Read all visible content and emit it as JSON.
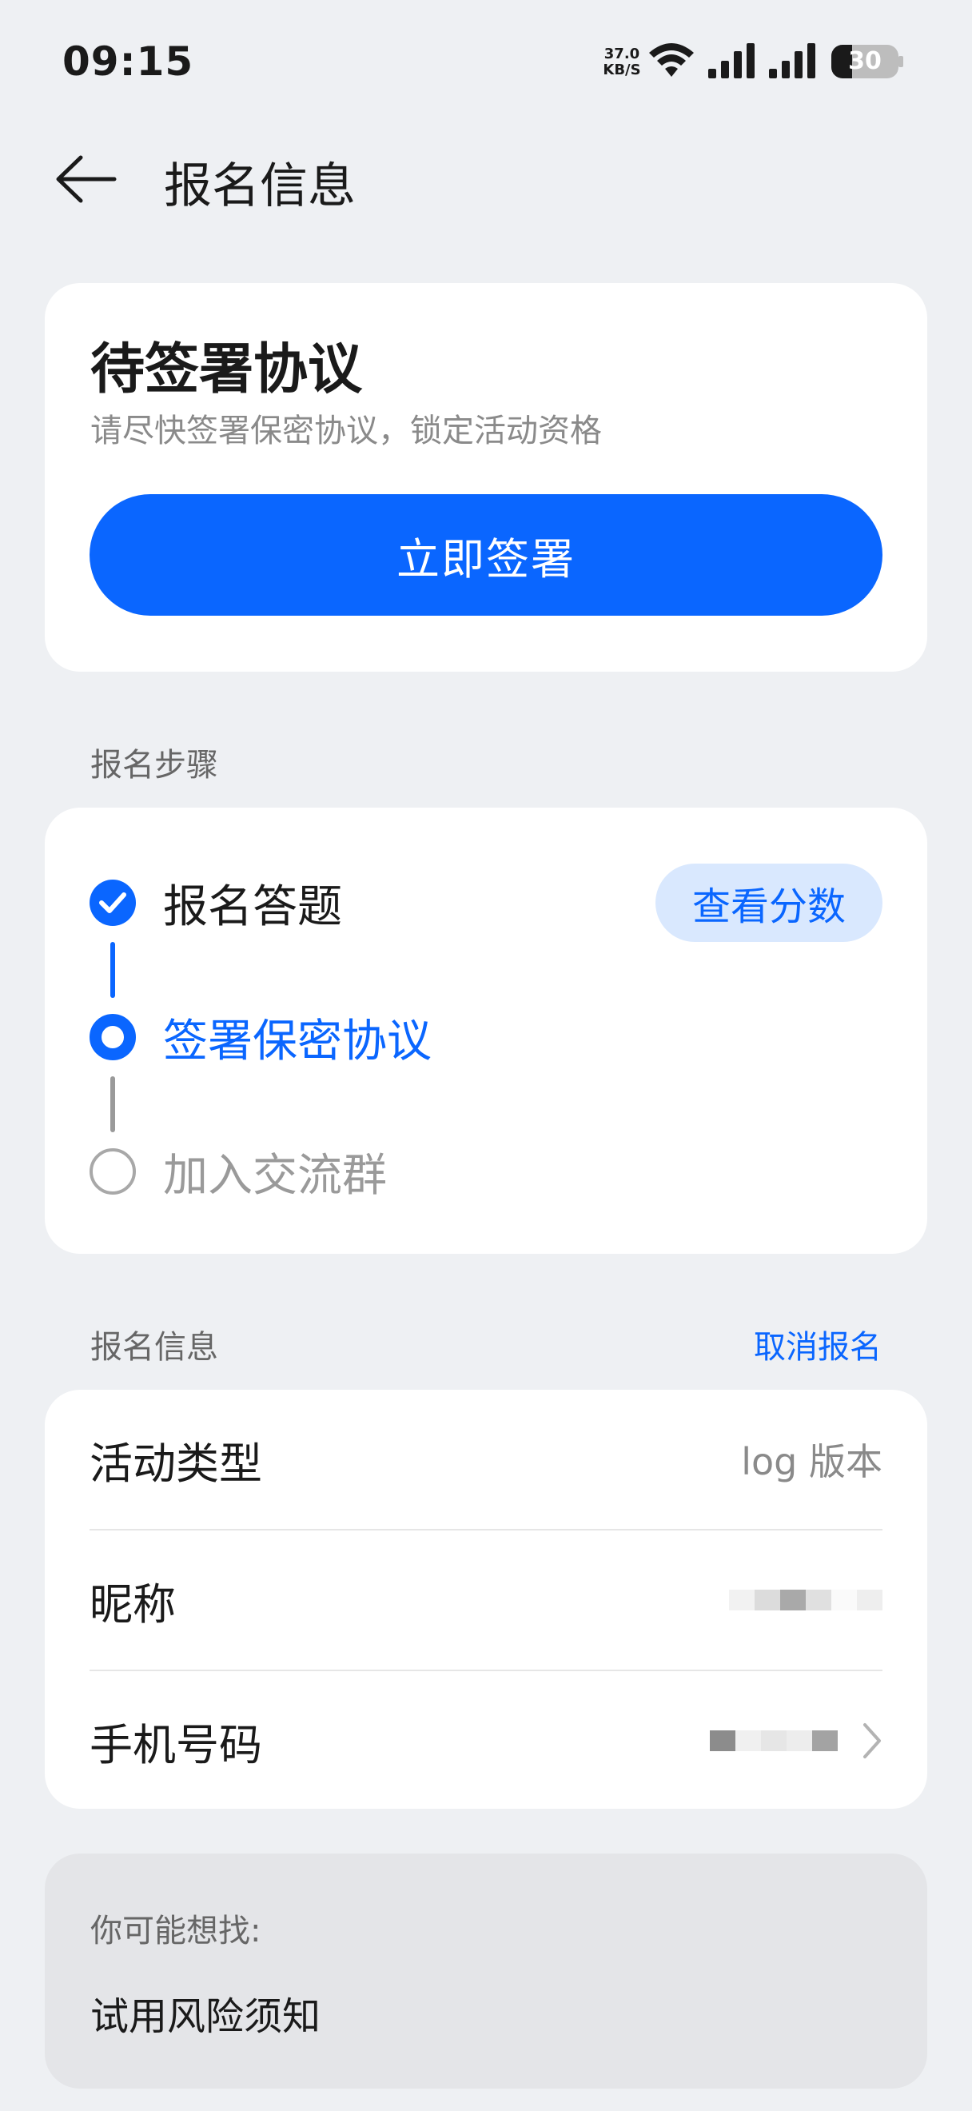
{
  "status_bar": {
    "time": "09:15",
    "net_speed_value": "37.0",
    "net_speed_unit": "KB/S",
    "battery": "30"
  },
  "header": {
    "title": "报名信息",
    "back_icon": "arrow-left-icon"
  },
  "sign_card": {
    "title": "待签署协议",
    "subtitle": "请尽快签署保密协议，锁定活动资格",
    "button_label": "立即签署"
  },
  "steps_section": {
    "label": "报名步骤",
    "steps": [
      {
        "label": "报名答题",
        "state": "done"
      },
      {
        "label": "签署保密协议",
        "state": "current"
      },
      {
        "label": "加入交流群",
        "state": "pending"
      }
    ],
    "score_button": "查看分数"
  },
  "info_section": {
    "label": "报名信息",
    "cancel_label": "取消报名",
    "rows": [
      {
        "label": "活动类型",
        "value": "log 版本"
      },
      {
        "label": "昵称",
        "value": ""
      },
      {
        "label": "手机号码",
        "value": ""
      }
    ]
  },
  "suggest_section": {
    "label": "你可能想找:",
    "link": "试用风险须知"
  },
  "colors": {
    "accent": "#0a66ff",
    "accent_light": "#d9e8fe",
    "background": "#eef0f3",
    "card": "#ffffff"
  }
}
